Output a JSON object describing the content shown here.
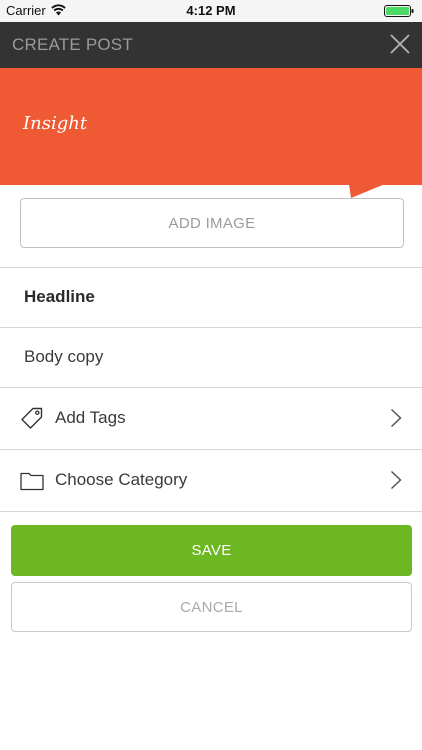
{
  "status_bar": {
    "carrier": "Carrier",
    "time": "4:12 PM"
  },
  "nav": {
    "title": "CREATE POST",
    "close_icon": "close-icon"
  },
  "banner": {
    "title": "Insight",
    "color": "#ef5a35"
  },
  "add_image": {
    "label": "ADD IMAGE"
  },
  "fields": {
    "headline": "Headline",
    "body": "Body copy"
  },
  "rows": {
    "tags": {
      "label": "Add Tags",
      "icon": "tag-icon"
    },
    "category": {
      "label": "Choose Category",
      "icon": "folder-icon"
    }
  },
  "actions": {
    "save_label": "SAVE",
    "cancel_label": "CANCEL",
    "save_color": "#6cb722"
  }
}
